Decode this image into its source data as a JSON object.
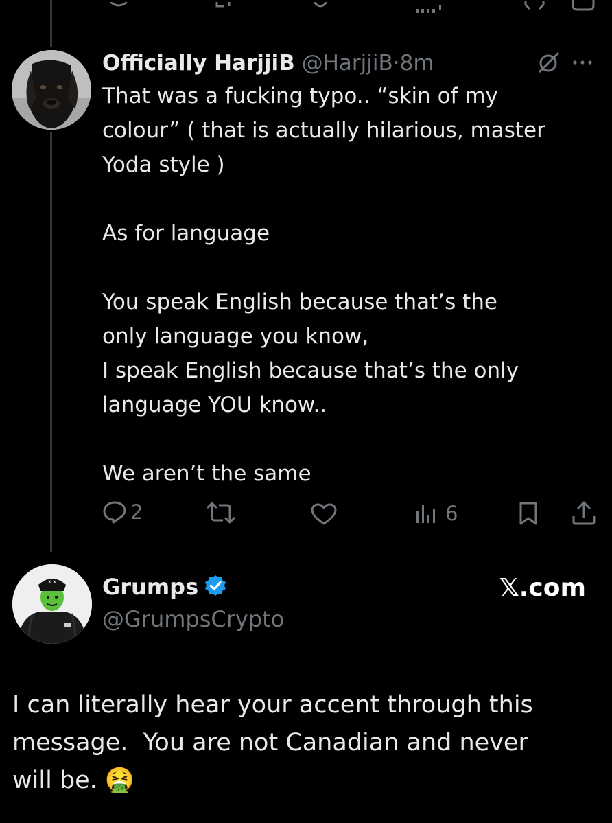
{
  "top_actions": [
    "reply-icon",
    "repost-icon",
    "like-icon",
    "views-icon",
    "bookmark-icon",
    "share-icon"
  ],
  "reply_tweet": {
    "display_name": "Officially HarjjiB",
    "handle": "@HarjjiB",
    "separator": "·",
    "time": "8m",
    "body": "That was a fucking typo.. “skin of my\ncolour” ( that is actually hilarious, master\nYoda style )\n\nAs for language\n\nYou speak English because that’s the\nonly language you know,\nI speak English because that’s the only\nlanguage YOU know..\n\nWe aren’t the same",
    "reply_count": "2",
    "view_count": "6"
  },
  "quoted_account": {
    "display_name": "Grumps",
    "handle": "@GrumpsCrypto",
    "verified": true,
    "verified_color": "#1d9bf0",
    "watermark": "𝕏.com"
  },
  "main_text": "I can literally hear your accent through this\nmessage.  You are not Canadian and never\nwill be. 🤮",
  "colors": {
    "background": "#000000",
    "text": "#e7e9ea",
    "muted": "#71767b",
    "verified": "#1d9bf0"
  }
}
